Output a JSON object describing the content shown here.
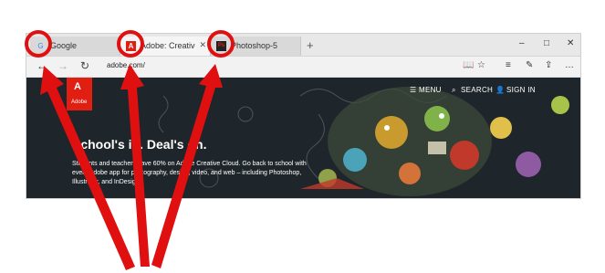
{
  "tabs": [
    {
      "favicon": "G",
      "title": "Google"
    },
    {
      "favicon": "A",
      "title": "Adobe: Creative, marke"
    },
    {
      "favicon": "Ps",
      "title": "Photoshop-5"
    }
  ],
  "tabbar": {
    "new_tab": "+",
    "min": "–",
    "max": "□",
    "close": "✕"
  },
  "toolbar": {
    "back_icon": "←",
    "forward_icon": "→",
    "refresh_icon": "↻",
    "url": "adobe.com/",
    "reading_icon": "📖",
    "star_icon": "☆",
    "hub_icon": "≡",
    "note_icon": "✎",
    "share_icon": "⇪",
    "more_icon": "…"
  },
  "page": {
    "logo_mark": "A",
    "logo_label": "Adobe",
    "menu": "☰ MENU",
    "search": "SEARCH",
    "signin": "SIGN IN",
    "headline": "School's in. Deal's on.",
    "blurb": "Students and teachers save 60% on Adobe Creative Cloud. Go back to school with every Adobe app for photography, design, video, and web – including Photoshop, Illustrator, and InDesign."
  },
  "colors": {
    "annotation": "#e01010",
    "adobe_red": "#e01e12",
    "hero_bg": "#1f262b"
  }
}
